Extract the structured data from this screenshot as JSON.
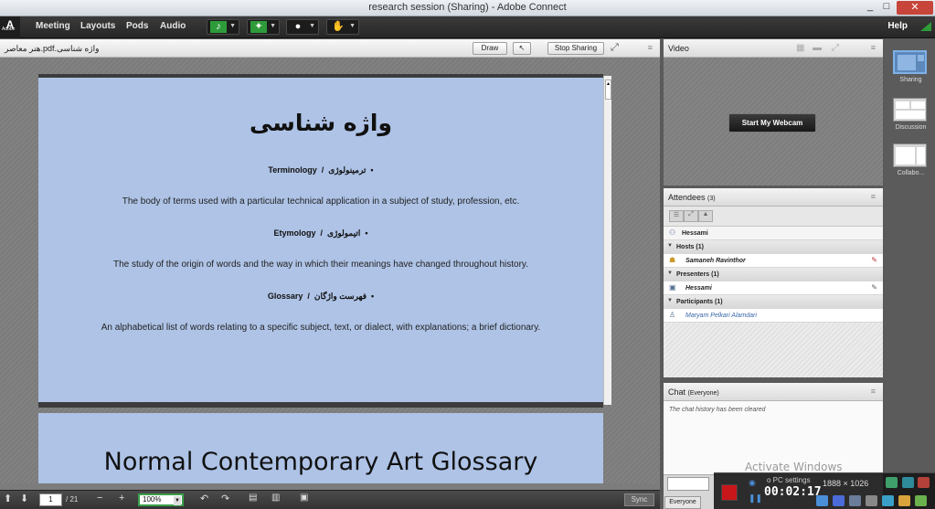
{
  "window": {
    "title": "research session (Sharing) - Adobe Connect",
    "minimize": "_",
    "maximize": "□",
    "close": "✕"
  },
  "menubar": {
    "logo": "A",
    "logo_sub": "Adobe",
    "items": [
      "Meeting",
      "Layouts",
      "Pods",
      "Audio"
    ],
    "help": "Help"
  },
  "share_pod": {
    "filename": "هنر معاصر.pdf.واژه شناسی",
    "buttons": {
      "draw": "Draw",
      "stop_sharing": "Stop Sharing"
    },
    "slide": {
      "title": "واژه شناسی",
      "terms": [
        {
          "en": "Terminology",
          "fa": "ترمینولوژی",
          "definition": "The body of terms used with a particular technical application in a subject of study, profession, etc."
        },
        {
          "en": "Etymology",
          "fa": "اتیمولوژی",
          "definition": "The study of the origin of words and the way in which their meanings have changed throughout history."
        },
        {
          "en": "Glossary",
          "fa": "فهرست واژگان",
          "definition": "An alphabetical list of words relating to a specific subject, text, or dialect, with explanations; a brief dictionary."
        }
      ]
    },
    "next_slide_title": "Normal Contemporary Art Glossary",
    "toolbar": {
      "page_current": "1",
      "page_total": "/ 21",
      "zoom": "100%",
      "sync": "Sync"
    }
  },
  "video_pod": {
    "title": "Video",
    "webcam_button": "Start My Webcam"
  },
  "attendees_pod": {
    "title": "Attendees",
    "count": "(3)",
    "current_user": "Hessami",
    "groups": [
      {
        "label": "Hosts (1)",
        "members": [
          "Samaneh Ravinthor"
        ]
      },
      {
        "label": "Presenters (1)",
        "members": [
          "Hessami"
        ]
      },
      {
        "label": "Participants (1)",
        "members": [
          "Maryam Pelkari Alamdari"
        ]
      }
    ]
  },
  "chat_pod": {
    "title": "Chat",
    "scope": "(Everyone)",
    "message": "The chat history has been cleared",
    "recipient": "Everyone"
  },
  "layouts": [
    {
      "label": "Sharing",
      "selected": true
    },
    {
      "label": "Discussion",
      "selected": false
    },
    {
      "label": "Collabo...",
      "selected": false
    }
  ],
  "overlay": {
    "activate_windows": "Activate Windows",
    "settings": "o PC settings",
    "resolution": "1888 × 1026",
    "timer": "00:02:17"
  },
  "colors": {
    "accent": "#3aa04a",
    "slide_bg": "#aec3e6",
    "stop_red": "#c8161b"
  }
}
